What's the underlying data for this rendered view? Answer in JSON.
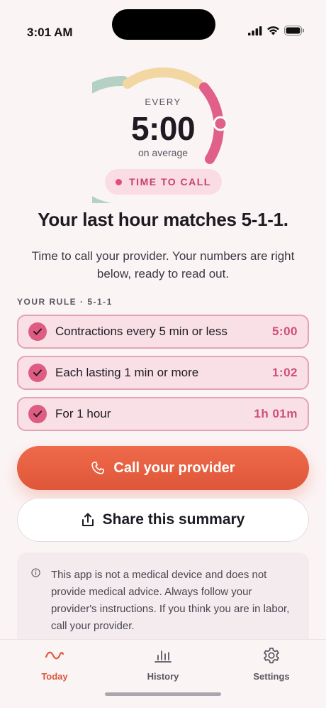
{
  "status_bar": {
    "time": "3:01 AM"
  },
  "gauge": {
    "every_label": "EVERY",
    "value": "5:00",
    "sub_label": "on average"
  },
  "badge": {
    "label": "TIME TO CALL"
  },
  "headline": "Your last hour matches 5-1-1.",
  "subtext": "Time to call your provider. Your numbers are right below, ready to read out.",
  "rule": {
    "label": "YOUR RULE · 5-1-1",
    "items": [
      {
        "text": "Contractions every 5 min or less",
        "value": "5:00",
        "checked": true
      },
      {
        "text": "Each lasting 1 min or more",
        "value": "1:02",
        "checked": true
      },
      {
        "text": "For 1 hour",
        "value": "1h 01m",
        "checked": true
      }
    ]
  },
  "actions": {
    "call_label": "Call your provider",
    "share_label": "Share this summary"
  },
  "disclaimer": {
    "text": "This app is not a medical device and does not provide medical advice. Always follow your provider's instructions. If you think you are in labor, call your provider."
  },
  "tabs": [
    {
      "label": "Today",
      "icon": "wave-icon",
      "active": true
    },
    {
      "label": "History",
      "icon": "bar-chart-icon",
      "active": false
    },
    {
      "label": "Settings",
      "icon": "gear-icon",
      "active": false
    }
  ],
  "colors": {
    "accent": "#DF5639",
    "pink": "#D14E77",
    "gauge_green": "#B5D1C6",
    "gauge_yellow": "#F3D7A3",
    "gauge_pink": "#E0608A"
  }
}
